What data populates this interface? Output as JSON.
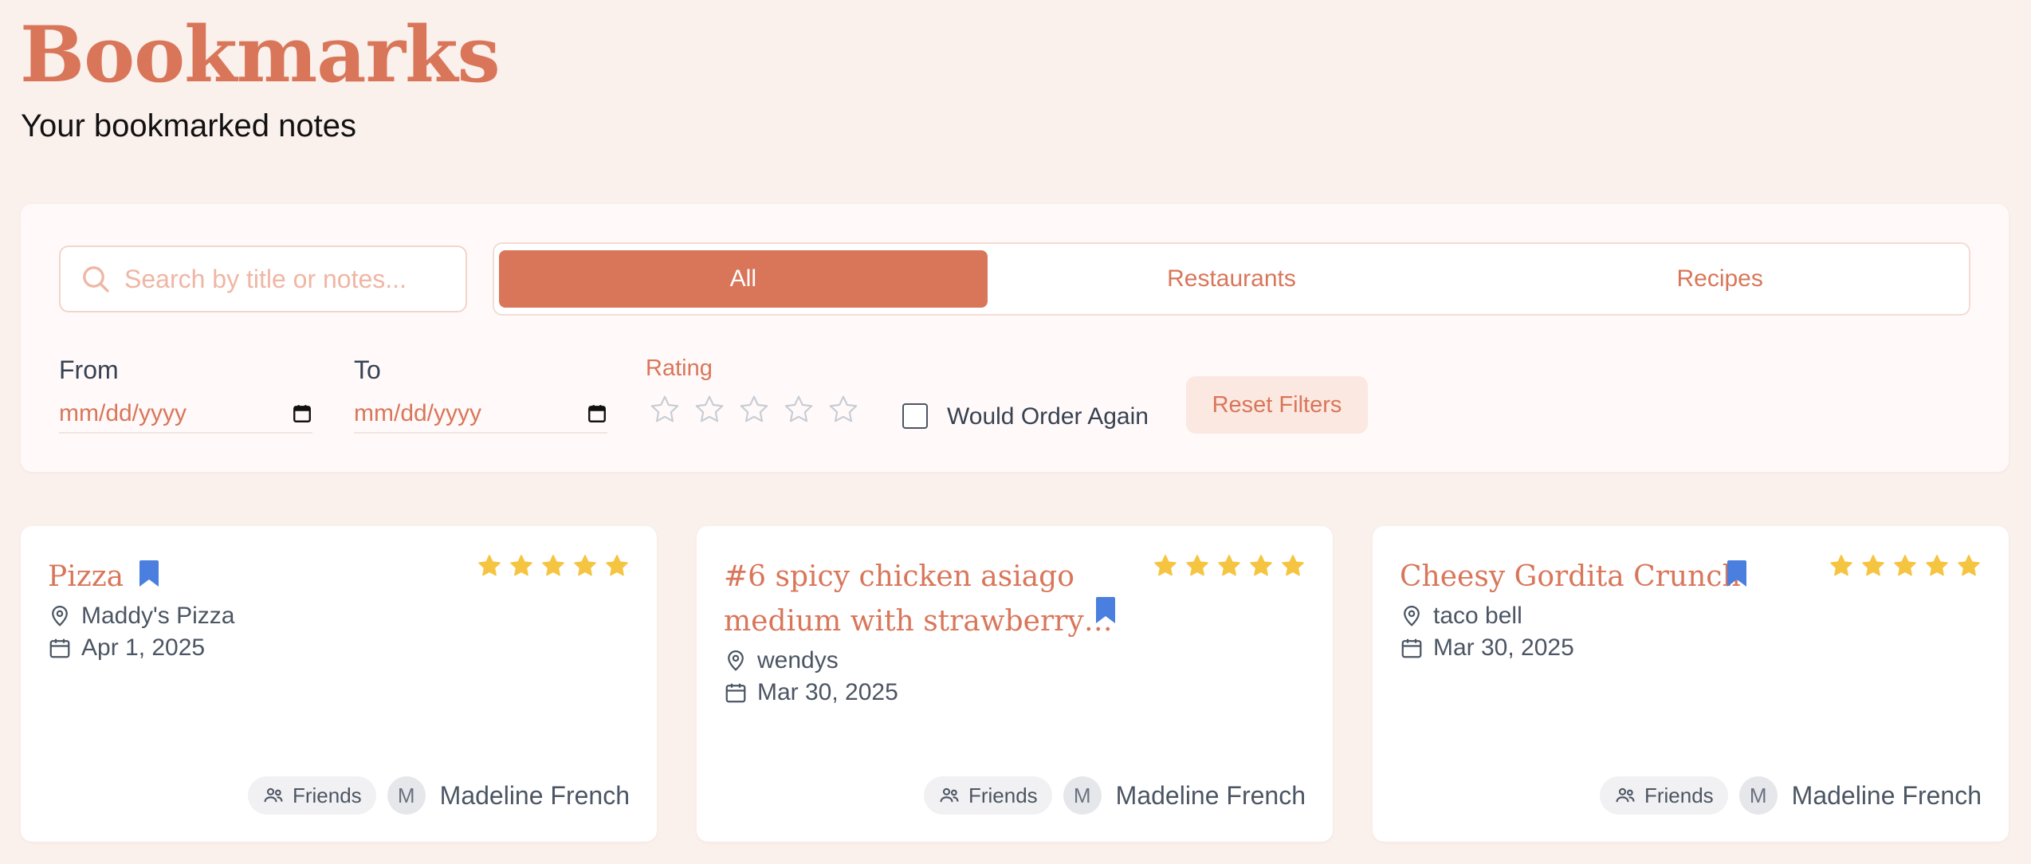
{
  "header": {
    "title": "Bookmarks",
    "subtitle": "Your bookmarked notes"
  },
  "filters": {
    "search_placeholder": "Search by title or notes...",
    "tabs": [
      {
        "label": "All",
        "active": true
      },
      {
        "label": "Restaurants",
        "active": false
      },
      {
        "label": "Recipes",
        "active": false
      }
    ],
    "from_label": "From",
    "to_label": "To",
    "from_value": "mm/dd/yyyy",
    "to_value": "mm/dd/yyyy",
    "rating_label": "Rating",
    "rating_value": 0,
    "rating_max": 5,
    "would_order_again_label": "Would Order Again",
    "would_order_again_checked": false,
    "reset_label": "Reset Filters"
  },
  "cards": [
    {
      "title": "Pizza",
      "location": "Maddy's Pizza",
      "date": "Apr 1, 2025",
      "rating": 5,
      "badge": "Friends",
      "avatar_initial": "M",
      "author": "Madeline French"
    },
    {
      "title": "#6 spicy chicken asiago medium with strawberry…",
      "title_line1": "#6 spicy chicken asiago",
      "title_line2": "medium with strawberry…",
      "location": "wendys",
      "date": "Mar 30, 2025",
      "rating": 5,
      "badge": "Friends",
      "avatar_initial": "M",
      "author": "Madeline French"
    },
    {
      "title": "Cheesy Gordita Crunch",
      "location": "taco bell",
      "date": "Mar 30, 2025",
      "rating": 5,
      "badge": "Friends",
      "avatar_initial": "M",
      "author": "Madeline French"
    }
  ],
  "colors": {
    "accent": "#d9765a",
    "background": "#faf0ec",
    "star_filled": "#f5c542",
    "star_empty": "#c8ccd4",
    "bookmark": "#4a7fe0"
  },
  "icons": {
    "search": "search-icon",
    "calendar": "calendar-icon",
    "location": "map-pin-icon",
    "bookmark": "bookmark-icon",
    "star": "star-icon",
    "friends": "users-icon"
  }
}
